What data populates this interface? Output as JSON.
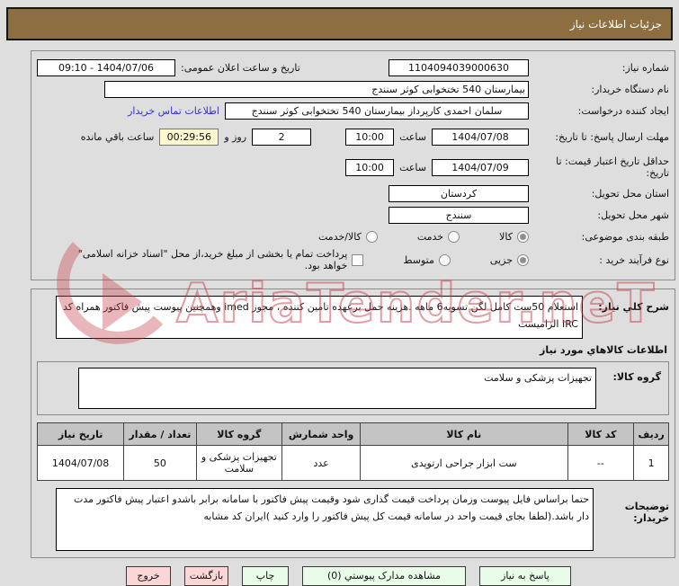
{
  "titlebar": {
    "title": "جزئیات اطلاعات نیاز"
  },
  "form": {
    "need_number": {
      "label": "شماره نیاز:",
      "value": "1104094039000630"
    },
    "announce": {
      "label": "تاریخ و ساعت اعلان عمومی:",
      "value": "1404/07/06 - 09:10"
    },
    "buyer_org": {
      "label": "نام دستگاه خریدار:",
      "value": "بیمارستان 540 تختخوابی کوثر سنندج"
    },
    "creator": {
      "label": "ایجاد کننده درخواست:",
      "value": "سلمان احمدی کارپرداز بیمارستان 540 تختخوابی کوثر سنندج",
      "contact_link": "اطلاعات تماس خریدار"
    },
    "deadline": {
      "label": "مهلت ارسال پاسخ: تا تاریخ:",
      "date": "1404/07/08",
      "hour_label": "ساعت",
      "time": "10:00",
      "days_value": "2",
      "days_label": "روز و",
      "countdown": "00:29:56",
      "remaining_label": "ساعت باقي مانده"
    },
    "validity": {
      "label": "حداقل تاریخ اعتبار قیمت: تا تاریخ:",
      "date": "1404/07/09",
      "hour_label": "ساعت",
      "time": "10:00"
    },
    "province": {
      "label": "استان محل تحویل:",
      "value": "کردستان"
    },
    "city": {
      "label": "شهر محل تحویل:",
      "value": "سنندج"
    },
    "subject": {
      "label": "طبقه بندی موضوعی:",
      "options": [
        {
          "label": "کالا",
          "selected": true
        },
        {
          "label": "خدمت",
          "selected": false
        },
        {
          "label": "کالا/خدمت",
          "selected": false
        }
      ]
    },
    "process": {
      "label": "نوع فرآیند خرید :",
      "options": [
        {
          "label": "جزیی",
          "selected": true
        },
        {
          "label": "متوسط",
          "selected": false
        }
      ],
      "treasury_checkbox": {
        "label": "پرداخت تمام یا بخشی از مبلغ خرید،از محل \"اسناد خزانه اسلامی\" خواهد بود.",
        "checked": false
      }
    }
  },
  "need_description": {
    "label": "شرح کلي نیاز:",
    "value": "استعلام 50ست کامل لگن تسویه6 ماهه .هزینه حمل برعهده تامین کننده ، مجوز imed وهمچنین پیوست پیش فاکتور همراه کد IRC  الزامیست"
  },
  "goods": {
    "section_header": "اطلاعات کالاهاي مورد نیاز",
    "group_label": "گروه کالا:",
    "group_value": "تجهیزات پزشکی و سلامت"
  },
  "items_table": {
    "headers": [
      "ردیف",
      "کد کالا",
      "نام کالا",
      "واحد شمارش",
      "گروه کالا",
      "تعداد / مقدار",
      "تاریخ نیاز"
    ],
    "rows": [
      [
        "1",
        "--",
        "ست ابزار جراحی ارتوپدی",
        "عدد",
        "تجهیزات پزشکی و سلامت",
        "50",
        "1404/07/08"
      ]
    ]
  },
  "buyer_notes": {
    "label": "توضیحات خریدار:",
    "value": "حتما براساس فایل پیوست  وزمان پرداخت قیمت گذاری شود وقیمت پیش فاکتور با سامانه برابر باشدو اعتبار پیش فاکتور مدت دار باشد.(لطفا بجای قیمت واحد در سامانه قیمت کل پیش فاکتور را وارد کنید )ایران کد مشابه"
  },
  "actions": [
    {
      "label": "پاسخ به نیاز",
      "style": "green"
    },
    {
      "label": "مشاهده مدارک پیوستي (0)",
      "style": "green"
    },
    {
      "label": "چاپ",
      "style": "green"
    },
    {
      "label": "بازگشت",
      "style": "pink"
    },
    {
      "label": "خروج",
      "style": "pink"
    }
  ],
  "watermark": {
    "text": "AriaTender.neT"
  },
  "colors": {
    "titlebar": "#8c6e40",
    "button_green": "#e9fbe9",
    "button_pink": "#fbd6d6",
    "countdown_bg": "#fdf6cf",
    "link": "#3333cc",
    "watermark_red": "#c6404a"
  }
}
